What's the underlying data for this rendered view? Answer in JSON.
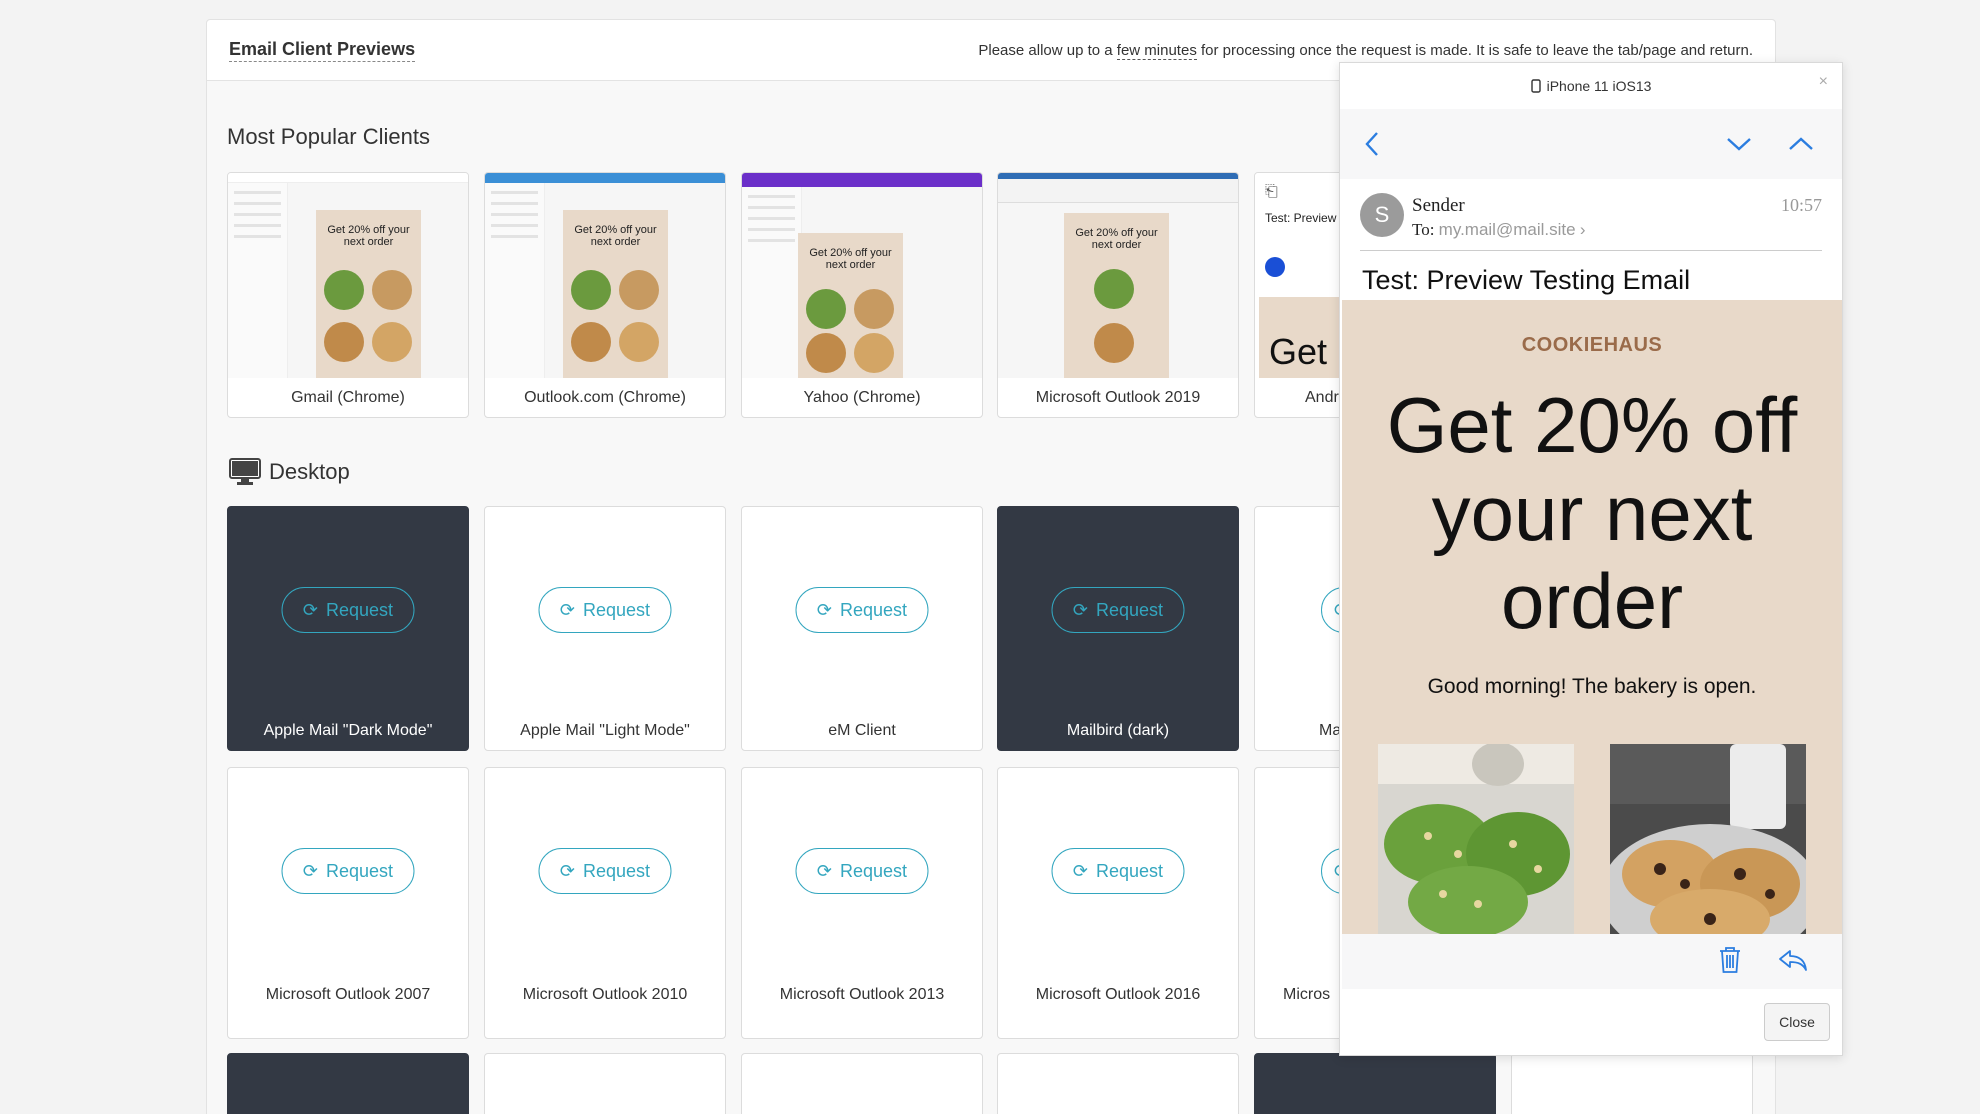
{
  "header": {
    "title": "Email Client Previews",
    "note_before": "Please allow up to a ",
    "note_link": "few minutes",
    "note_after": " for processing once the request is made. It is safe to leave the tab/page and return."
  },
  "popular": {
    "title": "Most Popular Clients",
    "thumb_headline": "Get 20% off your next order",
    "cards": [
      {
        "label": "Gmail (Chrome)",
        "bar_color": "#ffffff"
      },
      {
        "label": "Outlook.com (Chrome)",
        "bar_color": "#3b8fd6"
      },
      {
        "label": "Yahoo (Chrome)",
        "bar_color": "#6b2fc9"
      },
      {
        "label": "Microsoft Outlook 2019",
        "bar_color": "#2f6db5"
      },
      {
        "label": "Andr",
        "partial_subject": "Test: Preview",
        "partial_big": "Get"
      }
    ]
  },
  "desktop": {
    "title": "Desktop",
    "request_label": "Request",
    "row1": [
      {
        "label": "Apple Mail \"Dark Mode\"",
        "dark": true
      },
      {
        "label": "Apple Mail \"Light Mode\"",
        "dark": false
      },
      {
        "label": "eM Client",
        "dark": false
      },
      {
        "label": "Mailbird (dark)",
        "dark": true
      },
      {
        "label": "Ma",
        "dark": false
      }
    ],
    "row2": [
      {
        "label": "Microsoft Outlook 2007"
      },
      {
        "label": "Microsoft Outlook 2010"
      },
      {
        "label": "Microsoft Outlook 2013"
      },
      {
        "label": "Microsoft Outlook 2016"
      },
      {
        "label": "Micros"
      }
    ]
  },
  "modal": {
    "device": "iPhone 11 iOS13",
    "close_x": "×",
    "sender_initial": "S",
    "sender_name": "Sender",
    "to_label": "To:",
    "to_address": "my.mail@mail.site",
    "time": "10:57",
    "subject": "Test: Preview Testing Email",
    "brand": "COOKIEHAUS",
    "headline": "Get 20% off your next order",
    "greeting": "Good morning! The bakery is open.",
    "close_button": "Close"
  },
  "colors": {
    "accent": "#33a6bf",
    "dark_card": "#333944",
    "email_bg": "#e8d9c9",
    "brand": "#9a6b4a"
  }
}
